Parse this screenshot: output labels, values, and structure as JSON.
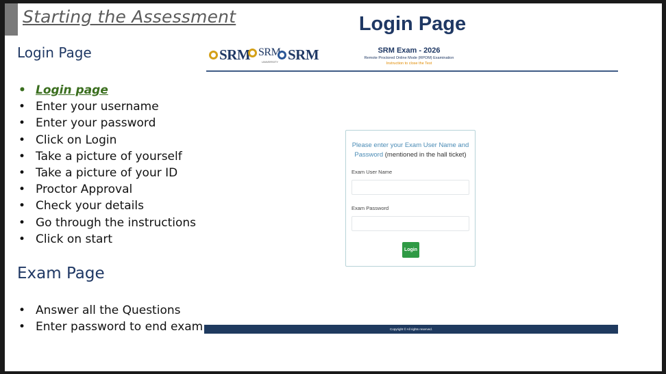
{
  "slide": {
    "title": "Starting the Assessment",
    "section1_heading": "Login Page",
    "section1_steps": [
      "Login page",
      "Enter your username",
      "Enter your password",
      "Click on Login",
      "Take a picture of yourself",
      "Take a picture of your ID",
      "Proctor Approval",
      "Check your details",
      "Go through the instructions",
      "Click on start"
    ],
    "section2_heading": "Exam Page",
    "section2_steps": [
      "Answer all the Questions",
      "Enter password to end exam"
    ]
  },
  "screenshot": {
    "heading": "Login Page",
    "logos": [
      {
        "name": "SRM",
        "icon": "srm-emblem-icon"
      },
      {
        "name": "SRM",
        "icon": "srm-emblem-icon",
        "sub": "UNIVERSITY"
      },
      {
        "name": "SRM",
        "icon": "srm-emblem-icon"
      }
    ],
    "exam_title": "SRM Exam - 2026",
    "exam_subtitle": "Remote Proctored Online Mode (RPOM) Examination",
    "exam_note": "Instruction to close the Test",
    "prompt_main": "Please enter your Exam User Name and Password",
    "prompt_paren": "(mentioned in the hall ticket)",
    "username_label": "Exam User Name",
    "username_value": "",
    "password_label": "Exam Password",
    "password_value": "",
    "login_button": "Login",
    "footer": "Copyright © All rights reserved."
  },
  "colors": {
    "heading": "#1f3864",
    "active_step": "#3a6e1e",
    "login_button": "#2f9a45",
    "footer_bar": "#1f3a5f"
  }
}
